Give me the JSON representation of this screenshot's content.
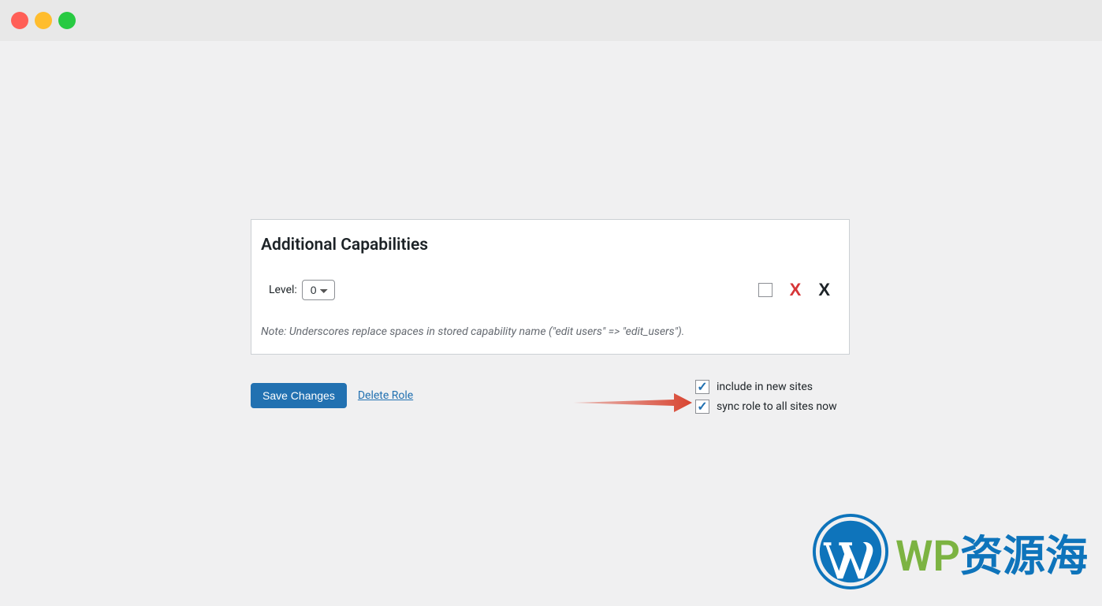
{
  "panel": {
    "title": "Additional Capabilities",
    "level_label": "Level:",
    "level_value": "0",
    "note": "Note: Underscores replace spaces in stored capability name (\"edit users\" => \"edit_users\")."
  },
  "actions": {
    "save_label": "Save Changes",
    "delete_label": "Delete Role"
  },
  "options": {
    "include_label": "include in new sites",
    "sync_label": "sync role to all sites now"
  },
  "watermark": {
    "text_wp": "WP",
    "text_cn": "资源海"
  }
}
